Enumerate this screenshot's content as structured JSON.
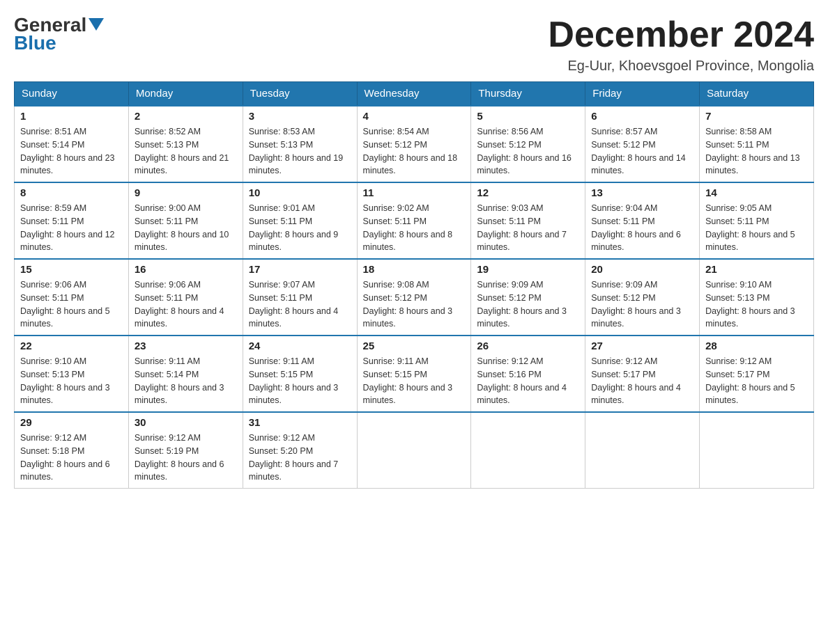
{
  "logo": {
    "general": "General",
    "blue": "Blue"
  },
  "header": {
    "month_year": "December 2024",
    "location": "Eg-Uur, Khoevsgoel Province, Mongolia"
  },
  "days_of_week": [
    "Sunday",
    "Monday",
    "Tuesday",
    "Wednesday",
    "Thursday",
    "Friday",
    "Saturday"
  ],
  "weeks": [
    [
      {
        "day": "1",
        "sunrise": "8:51 AM",
        "sunset": "5:14 PM",
        "daylight": "8 hours and 23 minutes."
      },
      {
        "day": "2",
        "sunrise": "8:52 AM",
        "sunset": "5:13 PM",
        "daylight": "8 hours and 21 minutes."
      },
      {
        "day": "3",
        "sunrise": "8:53 AM",
        "sunset": "5:13 PM",
        "daylight": "8 hours and 19 minutes."
      },
      {
        "day": "4",
        "sunrise": "8:54 AM",
        "sunset": "5:12 PM",
        "daylight": "8 hours and 18 minutes."
      },
      {
        "day": "5",
        "sunrise": "8:56 AM",
        "sunset": "5:12 PM",
        "daylight": "8 hours and 16 minutes."
      },
      {
        "day": "6",
        "sunrise": "8:57 AM",
        "sunset": "5:12 PM",
        "daylight": "8 hours and 14 minutes."
      },
      {
        "day": "7",
        "sunrise": "8:58 AM",
        "sunset": "5:11 PM",
        "daylight": "8 hours and 13 minutes."
      }
    ],
    [
      {
        "day": "8",
        "sunrise": "8:59 AM",
        "sunset": "5:11 PM",
        "daylight": "8 hours and 12 minutes."
      },
      {
        "day": "9",
        "sunrise": "9:00 AM",
        "sunset": "5:11 PM",
        "daylight": "8 hours and 10 minutes."
      },
      {
        "day": "10",
        "sunrise": "9:01 AM",
        "sunset": "5:11 PM",
        "daylight": "8 hours and 9 minutes."
      },
      {
        "day": "11",
        "sunrise": "9:02 AM",
        "sunset": "5:11 PM",
        "daylight": "8 hours and 8 minutes."
      },
      {
        "day": "12",
        "sunrise": "9:03 AM",
        "sunset": "5:11 PM",
        "daylight": "8 hours and 7 minutes."
      },
      {
        "day": "13",
        "sunrise": "9:04 AM",
        "sunset": "5:11 PM",
        "daylight": "8 hours and 6 minutes."
      },
      {
        "day": "14",
        "sunrise": "9:05 AM",
        "sunset": "5:11 PM",
        "daylight": "8 hours and 5 minutes."
      }
    ],
    [
      {
        "day": "15",
        "sunrise": "9:06 AM",
        "sunset": "5:11 PM",
        "daylight": "8 hours and 5 minutes."
      },
      {
        "day": "16",
        "sunrise": "9:06 AM",
        "sunset": "5:11 PM",
        "daylight": "8 hours and 4 minutes."
      },
      {
        "day": "17",
        "sunrise": "9:07 AM",
        "sunset": "5:11 PM",
        "daylight": "8 hours and 4 minutes."
      },
      {
        "day": "18",
        "sunrise": "9:08 AM",
        "sunset": "5:12 PM",
        "daylight": "8 hours and 3 minutes."
      },
      {
        "day": "19",
        "sunrise": "9:09 AM",
        "sunset": "5:12 PM",
        "daylight": "8 hours and 3 minutes."
      },
      {
        "day": "20",
        "sunrise": "9:09 AM",
        "sunset": "5:12 PM",
        "daylight": "8 hours and 3 minutes."
      },
      {
        "day": "21",
        "sunrise": "9:10 AM",
        "sunset": "5:13 PM",
        "daylight": "8 hours and 3 minutes."
      }
    ],
    [
      {
        "day": "22",
        "sunrise": "9:10 AM",
        "sunset": "5:13 PM",
        "daylight": "8 hours and 3 minutes."
      },
      {
        "day": "23",
        "sunrise": "9:11 AM",
        "sunset": "5:14 PM",
        "daylight": "8 hours and 3 minutes."
      },
      {
        "day": "24",
        "sunrise": "9:11 AM",
        "sunset": "5:15 PM",
        "daylight": "8 hours and 3 minutes."
      },
      {
        "day": "25",
        "sunrise": "9:11 AM",
        "sunset": "5:15 PM",
        "daylight": "8 hours and 3 minutes."
      },
      {
        "day": "26",
        "sunrise": "9:12 AM",
        "sunset": "5:16 PM",
        "daylight": "8 hours and 4 minutes."
      },
      {
        "day": "27",
        "sunrise": "9:12 AM",
        "sunset": "5:17 PM",
        "daylight": "8 hours and 4 minutes."
      },
      {
        "day": "28",
        "sunrise": "9:12 AM",
        "sunset": "5:17 PM",
        "daylight": "8 hours and 5 minutes."
      }
    ],
    [
      {
        "day": "29",
        "sunrise": "9:12 AM",
        "sunset": "5:18 PM",
        "daylight": "8 hours and 6 minutes."
      },
      {
        "day": "30",
        "sunrise": "9:12 AM",
        "sunset": "5:19 PM",
        "daylight": "8 hours and 6 minutes."
      },
      {
        "day": "31",
        "sunrise": "9:12 AM",
        "sunset": "5:20 PM",
        "daylight": "8 hours and 7 minutes."
      },
      null,
      null,
      null,
      null
    ]
  ]
}
